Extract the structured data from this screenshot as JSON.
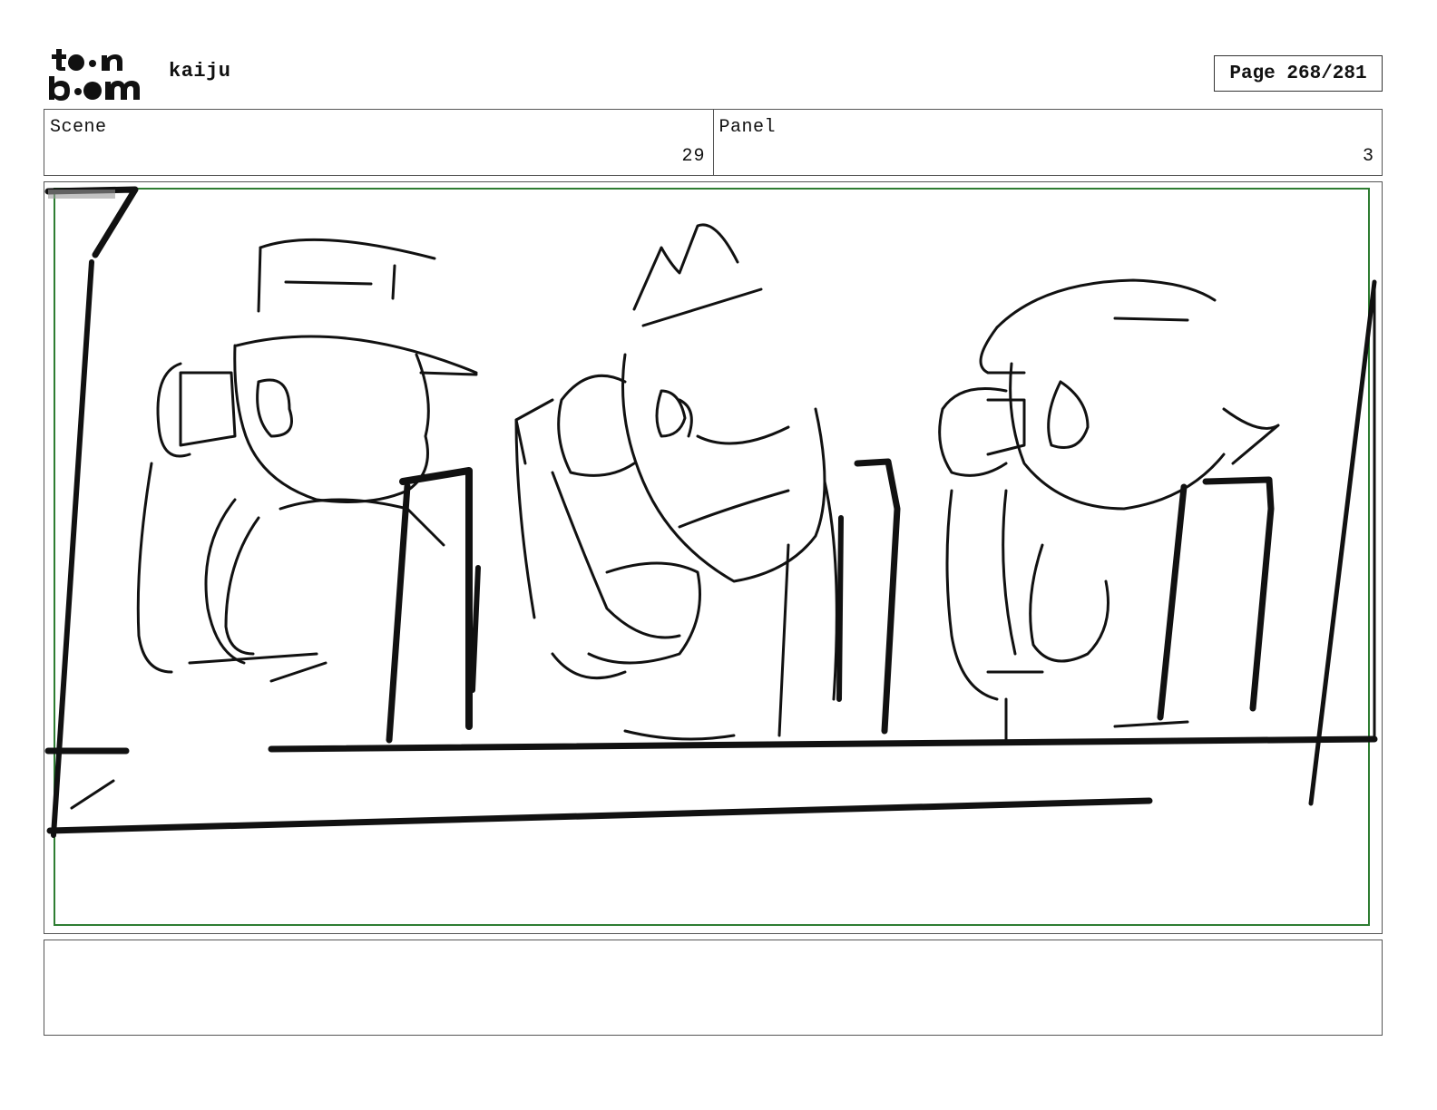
{
  "header": {
    "logo_text": "toon boom",
    "project_title": "kaiju",
    "page_label": "Page 268/281"
  },
  "info": {
    "scene_label": "Scene",
    "scene_value": "29",
    "panel_label": "Panel",
    "panel_value": "3"
  },
  "panel": {
    "image_description": "rough storyboard sketch",
    "safe_frame_color": "#2e7d32"
  },
  "notes": {
    "text": ""
  },
  "colors": {
    "ink": "#111111",
    "border": "#555555",
    "safe_frame": "#2e7d32"
  }
}
